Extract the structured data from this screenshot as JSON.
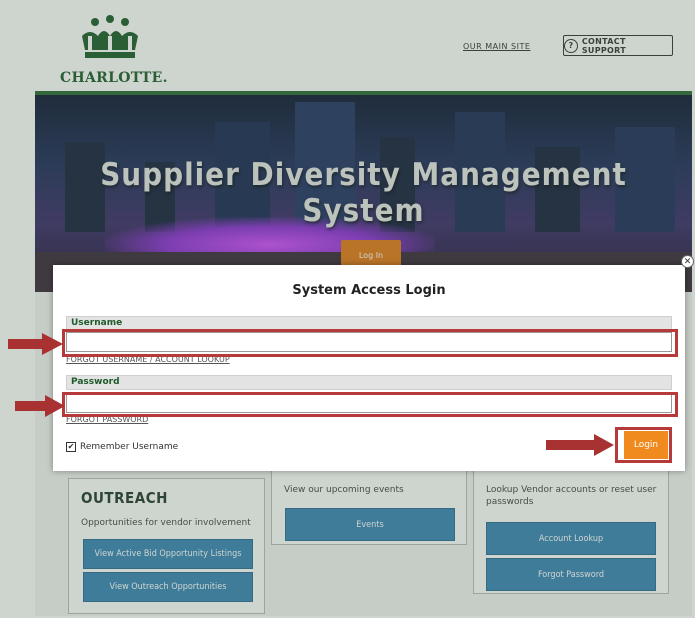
{
  "header": {
    "logo_text": "CHARLOTTE.",
    "main_site_link": "OUR MAIN SITE",
    "contact_support": "CONTACT SUPPORT",
    "contact_support_icon": "?"
  },
  "hero": {
    "title": "Supplier Diversity Management System",
    "login_button": "Log In"
  },
  "cards": {
    "outreach": {
      "heading": "OUTREACH",
      "desc": "Opportunities for vendor involvement",
      "btn1": "View Active Bid Opportunity Listings",
      "btn2": "View Outreach Opportunities"
    },
    "events": {
      "desc": "View our upcoming events",
      "btn": "Events"
    },
    "accounts": {
      "desc": "Lookup Vendor accounts or reset user passwords",
      "btn1": "Account Lookup",
      "btn2": "Forgot Password"
    }
  },
  "modal": {
    "title": "System Access Login",
    "username_label": "Username",
    "username_value": "",
    "forgot_username": "FORGOT USERNAME / ACCOUNT LOOKUP",
    "password_label": "Password",
    "password_value": "",
    "forgot_password": "FORGOT PASSWORD",
    "remember_label": "Remember Username",
    "remember_checked": "✔",
    "login_button": "Login",
    "close_icon": "✕"
  },
  "colors": {
    "brand_green": "#1d5c2c",
    "accent_orange": "#f08a1e",
    "highlight_red": "#b73a3a",
    "button_blue": "#3a86b8"
  }
}
